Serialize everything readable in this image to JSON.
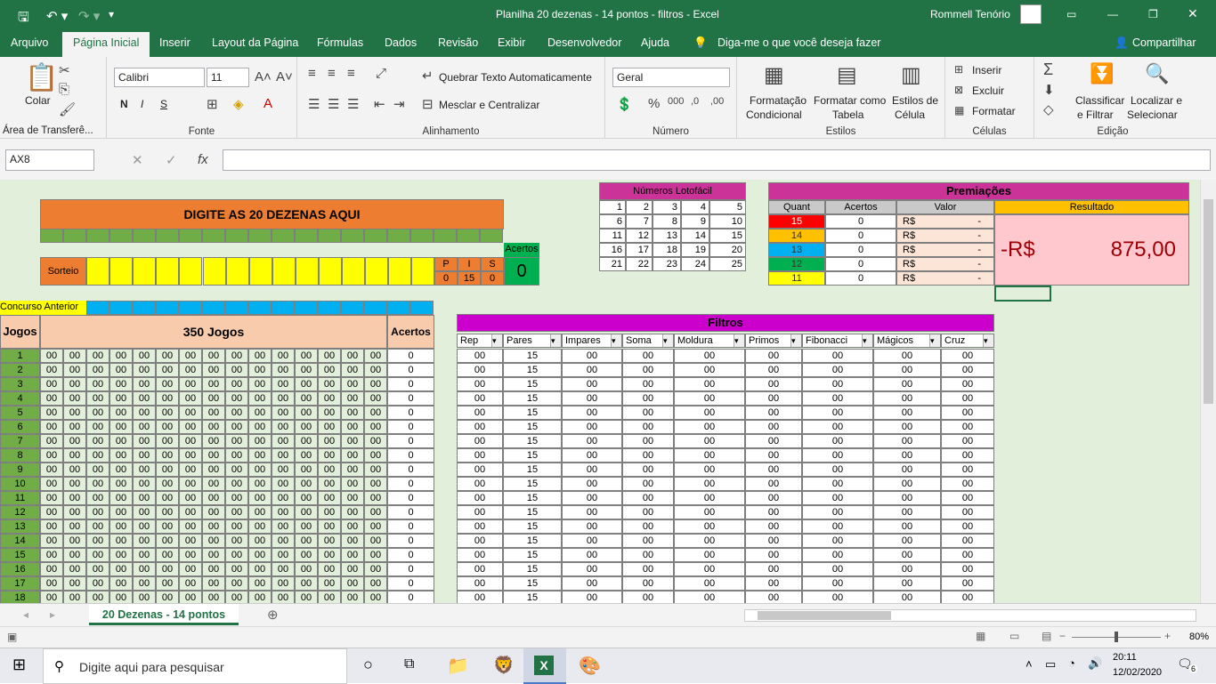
{
  "title": {
    "doc": "Planilha 20 dezenas - 14 pontos - filtros  -  Excel",
    "user": "Rommell Tenório"
  },
  "tabs": [
    "Arquivo",
    "Página Inicial",
    "Inserir",
    "Layout da Página",
    "Fórmulas",
    "Dados",
    "Revisão",
    "Exibir",
    "Desenvolvedor",
    "Ajuda"
  ],
  "tell_me": "Diga-me o que você deseja fazer",
  "share": "Compartilhar",
  "ribbon": {
    "clipboard": {
      "paste": "Colar",
      "label": "Área de Transferê..."
    },
    "font": {
      "name": "Calibri",
      "size": "11",
      "bold": "N",
      "italic": "I",
      "underline": "S",
      "label": "Fonte"
    },
    "align": {
      "wrap": "Quebrar Texto Automaticamente",
      "merge": "Mesclar e Centralizar",
      "label": "Alinhamento"
    },
    "number": {
      "format": "Geral",
      "label": "Número"
    },
    "styles": {
      "cond1": "Formatação",
      "cond2": "Condicional",
      "table1": "Formatar como",
      "table2": "Tabela",
      "cell1": "Estilos de",
      "cell2": "Célula",
      "label": "Estilos"
    },
    "cells": {
      "insert": "Inserir",
      "delete": "Excluir",
      "format": "Formatar",
      "label": "Células"
    },
    "editing": {
      "sort1": "Classificar",
      "sort2": "e Filtrar",
      "find1": "Localizar e",
      "find2": "Selecionar",
      "label": "Edição"
    }
  },
  "namebox": "AX8",
  "sheet": {
    "digite": "DIGITE AS 20 DEZENAS AQUI",
    "sorteio": "Sorteio",
    "pis_h": [
      "P",
      "I",
      "S"
    ],
    "pis_v": [
      "0",
      "15",
      "0"
    ],
    "acertos_label": "Acertos",
    "acertos_val": "0",
    "concurso": "Concurso Anterior",
    "jogos_h": "Jogos",
    "jogos_title": "350 Jogos",
    "acertos_h": "Acertos",
    "row_nums": [
      "1",
      "2",
      "3",
      "4",
      "5",
      "6",
      "7",
      "8",
      "9",
      "10",
      "11",
      "12",
      "13",
      "14",
      "15",
      "16",
      "17",
      "18"
    ],
    "cell_zero": "00",
    "acertos_zero": "0",
    "lotofacil_title": "Números Lotofácil",
    "lotofacil": [
      [
        "1",
        "2",
        "3",
        "4",
        "5"
      ],
      [
        "6",
        "7",
        "8",
        "9",
        "10"
      ],
      [
        "11",
        "12",
        "13",
        "14",
        "15"
      ],
      [
        "16",
        "17",
        "18",
        "19",
        "20"
      ],
      [
        "21",
        "22",
        "23",
        "24",
        "25"
      ]
    ],
    "prem_title": "Premiações",
    "prem_h": [
      "Quant",
      "Acertos",
      "Valor",
      "Resultado"
    ],
    "prem_quant": [
      "15",
      "14",
      "13",
      "12",
      "11"
    ],
    "prem_colors": [
      "#ff0000",
      "#ffc000",
      "#00b0f0",
      "#00b050",
      "#ffff00"
    ],
    "prem_acertos": "0",
    "prem_rs": "R$",
    "prem_dash": "-",
    "result_prefix": "-R$",
    "result_value": "875,00",
    "filtros_title": "Filtros",
    "filtros_h": [
      "Rep",
      "Pares",
      "Impares",
      "Soma",
      "Moldura",
      "Primos",
      "Fibonacci",
      "Mágicos",
      "Cruz"
    ],
    "filtros_row": [
      "00",
      "15",
      "00",
      "00",
      "00",
      "00",
      "00",
      "00",
      "00"
    ]
  },
  "sheet_tab": "20 Dezenas - 14 pontos",
  "zoom": "80%",
  "taskbar": {
    "search": "Digite aqui para pesquisar",
    "time": "20:11",
    "date": "12/02/2020",
    "notif": "6"
  }
}
